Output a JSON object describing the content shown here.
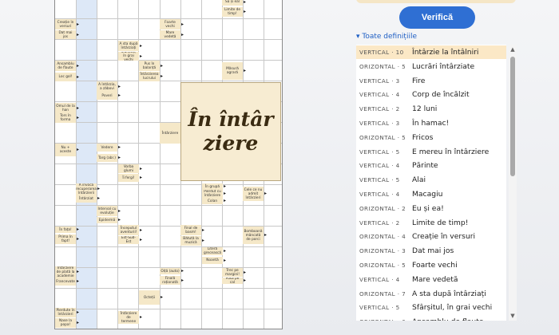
{
  "puzzle": {
    "title": "În întârziere",
    "clues": [
      {
        "id": "c1",
        "text": "Sa și eal"
      },
      {
        "id": "c2",
        "text": "Limite de timp!"
      },
      {
        "id": "c3",
        "text": "Creație în versuri"
      },
      {
        "id": "c4",
        "text": "Foarte vechi"
      },
      {
        "id": "c5",
        "text": "Dat mai jos"
      },
      {
        "id": "c6",
        "text": "Mare vedetă"
      },
      {
        "id": "c7",
        "text": "A sta după întârziați"
      },
      {
        "id": "c8",
        "text": "Sfârșitul, în grai vechi"
      },
      {
        "id": "c9",
        "text": "Ansamblu de flaute"
      },
      {
        "id": "c10",
        "text": "Pus în balanță"
      },
      {
        "id": "c11",
        "text": "Măsură agrară"
      },
      {
        "id": "c12",
        "text": "Loc gol!"
      },
      {
        "id": "c13",
        "text": "Întârzierea lucrului"
      },
      {
        "id": "c14",
        "text": "A întârzia, a zăbovi"
      },
      {
        "id": "c15",
        "text": "Poveri"
      },
      {
        "id": "c16",
        "text": "Omul de la han"
      },
      {
        "id": "c17",
        "text": "Tors în forma"
      },
      {
        "id": "c18",
        "text": "Întârziere"
      },
      {
        "id": "c19",
        "text": "Nu + aceste"
      },
      {
        "id": "c20",
        "text": "Vedere"
      },
      {
        "id": "c21",
        "text": "Targ (abr.)"
      },
      {
        "id": "c22",
        "text": "Vorba glumi"
      },
      {
        "id": "c23",
        "text": "Îi fergi!"
      },
      {
        "id": "c24",
        "text": "În grupă"
      },
      {
        "id": "c25",
        "text": "Pierdut cu întârziere"
      },
      {
        "id": "c26",
        "text": "Colan"
      },
      {
        "id": "c27",
        "text": "Cele ce nu admit întârzieri"
      },
      {
        "id": "c28",
        "text": "A invoca recuperarea întârzierii"
      },
      {
        "id": "c29",
        "text": "Întârziat"
      },
      {
        "id": "c30",
        "text": "Interval cu evoluție"
      },
      {
        "id": "c31",
        "text": "Epidermă"
      },
      {
        "id": "c32",
        "text": "În fața!"
      },
      {
        "id": "c33",
        "text": "Începutul aventurii!"
      },
      {
        "id": "c34",
        "text": "Final de basm!"
      },
      {
        "id": "c35",
        "text": "Bomboană mâncată de porci"
      },
      {
        "id": "c36",
        "text": "Prima în fapt!"
      },
      {
        "id": "c37",
        "text": "Est-Sud-Est"
      },
      {
        "id": "c38",
        "text": "Bătută la muzică"
      },
      {
        "id": "c39",
        "text": "Literă grecească"
      },
      {
        "id": "c40",
        "text": "Noantă"
      },
      {
        "id": "c41",
        "text": "Întârziere de plată la academie"
      },
      {
        "id": "c42",
        "text": "Oiță (auto)"
      },
      {
        "id": "c43",
        "text": "Trec pe margini!"
      },
      {
        "id": "c44",
        "text": "Finală raționată"
      },
      {
        "id": "c45",
        "text": "Pusă pe cal"
      },
      {
        "id": "c46",
        "text": "Francevate"
      },
      {
        "id": "c47",
        "text": "Octeții"
      },
      {
        "id": "c48",
        "text": "Pierdute în întârzieri"
      },
      {
        "id": "c49",
        "text": "Nase la popa!"
      },
      {
        "id": "c50",
        "text": "Întârziere de termene"
      }
    ]
  },
  "panel": {
    "verify_label": "Verifică",
    "definitions_header": "▾ Toate definițiile",
    "definitions": [
      {
        "dir": "VERTICAL · 10",
        "text": "Întârzie la întâlniri",
        "active": true
      },
      {
        "dir": "ORIZONTAL · 5",
        "text": "Lucrări întârziate"
      },
      {
        "dir": "VERTICAL · 3",
        "text": "Fire"
      },
      {
        "dir": "VERTICAL · 4",
        "text": "Corp de încălzit"
      },
      {
        "dir": "VERTICAL · 2",
        "text": "12 luni"
      },
      {
        "dir": "VERTICAL · 3",
        "text": "În hamac!"
      },
      {
        "dir": "ORIZONTAL · 5",
        "text": "Fricos"
      },
      {
        "dir": "VERTICAL · 5",
        "text": "E mereu în întârziere"
      },
      {
        "dir": "VERTICAL · 4",
        "text": "Părinte"
      },
      {
        "dir": "VERTICAL · 5",
        "text": "Alai"
      },
      {
        "dir": "VERTICAL · 4",
        "text": "Macagiu"
      },
      {
        "dir": "ORIZONTAL · 2",
        "text": "Eu și ea!"
      },
      {
        "dir": "VERTICAL · 2",
        "text": "Limite de timp!"
      },
      {
        "dir": "ORIZONTAL · 4",
        "text": "Creație în versuri"
      },
      {
        "dir": "ORIZONTAL · 3",
        "text": "Dat mai jos"
      },
      {
        "dir": "ORIZONTAL · 5",
        "text": "Foarte vechi"
      },
      {
        "dir": "VERTICAL · 4",
        "text": "Mare vedetă"
      },
      {
        "dir": "ORIZONTAL · 7",
        "text": "A sta după întârziați"
      },
      {
        "dir": "VERTICAL · 5",
        "text": "Sfârșitul, în grai vechi"
      },
      {
        "dir": "ORIZONTAL · 6",
        "text": "Ansamblu de flaute"
      }
    ]
  }
}
